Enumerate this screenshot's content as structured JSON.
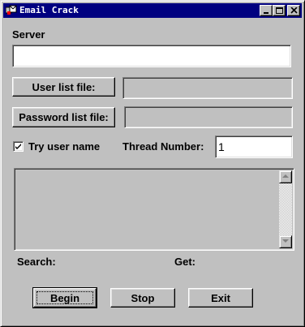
{
  "window": {
    "title": "Email Crack",
    "icon": "app-icon",
    "controls": [
      "minimize-icon",
      "maximize-icon",
      "close-icon"
    ]
  },
  "form": {
    "server_label": "Server",
    "server_value": "",
    "user_list_button": "User list file:",
    "user_list_value": "",
    "password_list_button": "Password list file:",
    "password_list_value": "",
    "try_user_name_label": "Try user name",
    "try_user_name_checked": true,
    "thread_label": "Thread Number:",
    "thread_value": "1"
  },
  "status": {
    "search_label": "Search:",
    "get_label": "Get:"
  },
  "buttons": {
    "begin": "Begin",
    "stop": "Stop",
    "exit": "Exit"
  }
}
